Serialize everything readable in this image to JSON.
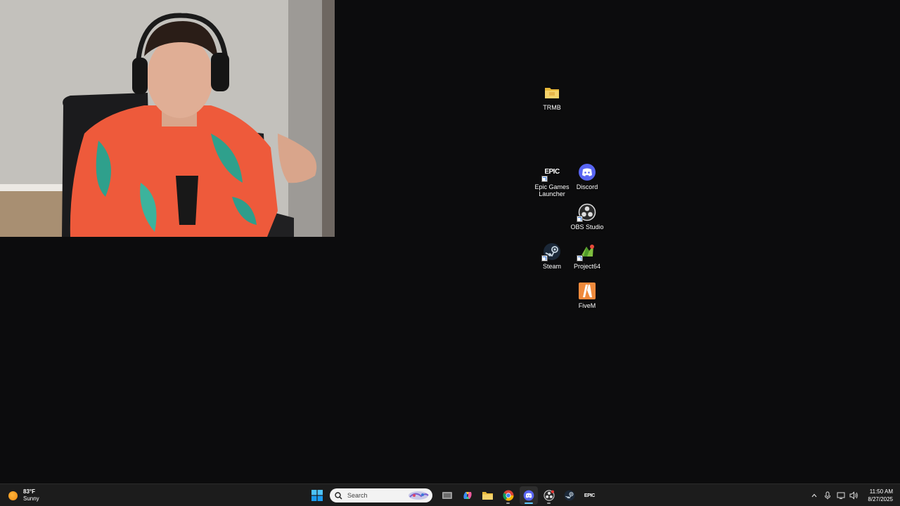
{
  "webcam": {
    "description_icon": "webcam-person-icon"
  },
  "desktop_icons": [
    {
      "id": "trmb",
      "label": "TRMB",
      "icon": "folder-icon"
    },
    {
      "id": "epic",
      "label": "Epic Games Launcher",
      "icon": "epic-games-icon",
      "logo_text": "EPIC"
    },
    {
      "id": "discord",
      "label": "Discord",
      "icon": "discord-icon"
    },
    {
      "id": "obs",
      "label": "OBS Studio",
      "icon": "obs-icon"
    },
    {
      "id": "steam",
      "label": "Steam",
      "icon": "steam-icon"
    },
    {
      "id": "project64",
      "label": "Project64",
      "icon": "project64-icon"
    },
    {
      "id": "fivem",
      "label": "FiveM",
      "icon": "fivem-icon"
    }
  ],
  "taskbar": {
    "weather": {
      "temp": "83°F",
      "condition": "Sunny"
    },
    "search": {
      "placeholder": "Search"
    },
    "pinned": [
      {
        "name": "task-view",
        "icon": "task-view-icon"
      },
      {
        "name": "copilot",
        "icon": "copilot-icon"
      },
      {
        "name": "file-explorer",
        "icon": "folder-icon"
      },
      {
        "name": "chrome",
        "icon": "chrome-icon"
      },
      {
        "name": "discord",
        "icon": "discord-icon",
        "active": true
      },
      {
        "name": "obs",
        "icon": "obs-icon"
      },
      {
        "name": "steam",
        "icon": "steam-icon"
      },
      {
        "name": "epic",
        "icon": "epic-games-icon",
        "logo_text": "EPIC"
      }
    ],
    "tray": {
      "icons": [
        "chevron-up-icon",
        "microphone-icon",
        "display-icon",
        "speaker-icon"
      ]
    },
    "clock": {
      "time": "11:50 AM",
      "date": "8/27/2025"
    }
  },
  "colors": {
    "desktop_bg": "#0c0c0d",
    "taskbar_bg": "#1c1c1c",
    "discord": "#5865f2",
    "accent": "#60cdff"
  }
}
